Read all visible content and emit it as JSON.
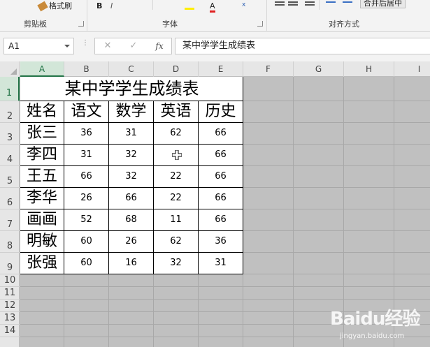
{
  "ribbon": {
    "format_painter": "格式刷",
    "groups": {
      "clipboard": "剪贴板",
      "font": "字体",
      "alignment": "对齐方式"
    },
    "bold": "B",
    "font_color": "A",
    "merge_center": "合并后居中"
  },
  "formula_bar": {
    "name_box": "A1",
    "cancel": "✕",
    "enter": "✓",
    "fx": "fx",
    "content": "某中学学生成绩表"
  },
  "columns": [
    "A",
    "B",
    "C",
    "D",
    "E",
    "F",
    "G",
    "H",
    "I"
  ],
  "rows": [
    "1",
    "2",
    "3",
    "4",
    "5",
    "6",
    "7",
    "8",
    "9",
    "10",
    "11",
    "12",
    "13",
    "14"
  ],
  "table": {
    "title": "某中学学生成绩表",
    "headers": [
      "姓名",
      "语文",
      "数学",
      "英语",
      "历史"
    ],
    "data": [
      [
        "张三",
        "36",
        "31",
        "62",
        "66"
      ],
      [
        "李四",
        "31",
        "32",
        "",
        "66"
      ],
      [
        "王五",
        "66",
        "32",
        "22",
        "66"
      ],
      [
        "李华",
        "26",
        "66",
        "22",
        "66"
      ],
      [
        "画画",
        "52",
        "68",
        "11",
        "66"
      ],
      [
        "明敏",
        "60",
        "26",
        "62",
        "36"
      ],
      [
        "张强",
        "60",
        "16",
        "32",
        "31"
      ]
    ]
  },
  "watermark": {
    "brand": "Baidu经验",
    "url": "jingyan.baidu.com"
  }
}
